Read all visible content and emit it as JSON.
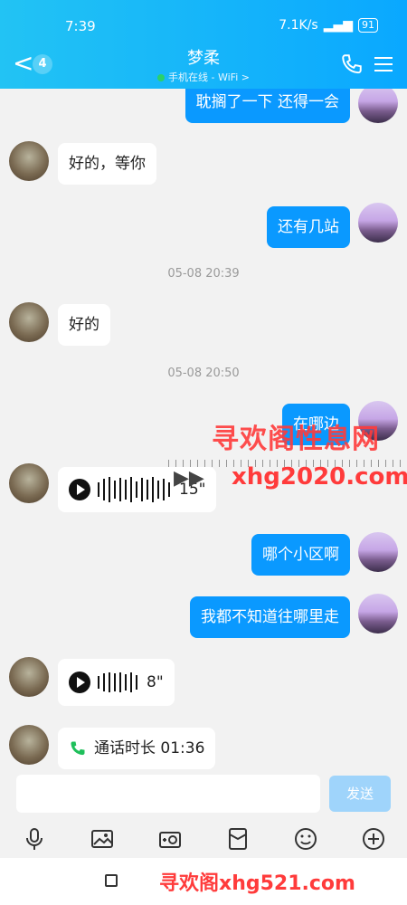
{
  "status": {
    "time": "7:39",
    "speed": "7.1K/s",
    "battery": "91"
  },
  "header": {
    "back_badge": "4",
    "title": "梦柔",
    "subtitle": "手机在线 - WiFi >"
  },
  "messages": {
    "m1": "耽搁了一下 还得一会",
    "m2": "好的，等你",
    "m3": "还有几站",
    "t1": "05-08 20:39",
    "m4": "好的",
    "t2": "05-08 20:50",
    "m5": "在哪边",
    "m6_duration": "15\"",
    "m7": "哪个小区啊",
    "m8": "我都不知道往哪里走",
    "m9_duration": "8\"",
    "m10": "通话时长 01:36"
  },
  "input": {
    "placeholder": "",
    "send_label": "发送"
  },
  "toolbar": {
    "icons": [
      "mic-icon",
      "image-icon",
      "camera-icon",
      "red-envelope-icon",
      "emoji-icon",
      "plus-icon"
    ]
  },
  "watermarks": {
    "w1": "寻欢阁性息网",
    "w2": "xhg2020.com",
    "w3": "寻欢阁xhg521.com"
  },
  "colors": {
    "accent": "#0a99ff",
    "header": "#22c3f4"
  }
}
